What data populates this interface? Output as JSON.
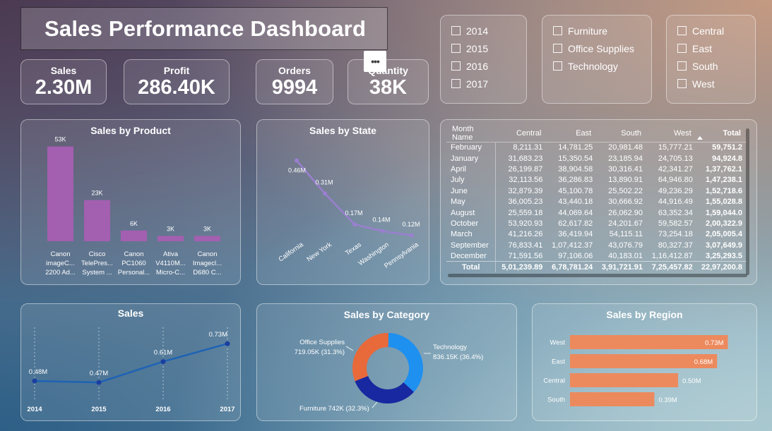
{
  "header": {
    "title": "Sales Performance Dashboard",
    "more_label": "•••"
  },
  "kpis": [
    {
      "label": "Sales",
      "value": "2.30M"
    },
    {
      "label": "Profit",
      "value": "286.40K"
    },
    {
      "label": "Orders",
      "value": "9994"
    },
    {
      "label": "Quantity",
      "value": "38K"
    }
  ],
  "slicers": {
    "years": [
      "2014",
      "2015",
      "2016",
      "2017"
    ],
    "categories": [
      "Furniture",
      "Office Supplies",
      "Technology"
    ],
    "regions": [
      "Central",
      "East",
      "South",
      "West"
    ]
  },
  "sales_by_product": {
    "title": "Sales by Product",
    "bar_color": "#a35fb0",
    "chart_data": {
      "type": "bar",
      "categories": [
        [
          "Canon",
          "imageC...",
          "2200 Ad..."
        ],
        [
          "Cisco",
          "TelePres...",
          "System ..."
        ],
        [
          "Canon",
          "PC1060",
          "Personal..."
        ],
        [
          "Ativa",
          "V4110M...",
          "Micro-C..."
        ],
        [
          "Canon",
          "Imagecl...",
          "D680 C..."
        ]
      ],
      "values": [
        53,
        23,
        6,
        3,
        3
      ],
      "data_labels": [
        "53K",
        "23K",
        "6K",
        "3K",
        "3K"
      ],
      "ylim": [
        0,
        56
      ]
    }
  },
  "sales_by_state": {
    "title": "Sales by State",
    "line_color": "#9a7fd0",
    "chart_data": {
      "type": "line",
      "categories": [
        "California",
        "New York",
        "Texas",
        "Washington",
        "Pennsylvania"
      ],
      "values": [
        0.46,
        0.31,
        0.17,
        0.14,
        0.12
      ],
      "data_labels": [
        "0.46M",
        "0.31M",
        "0.17M",
        "0.14M",
        "0.12M"
      ],
      "ylim": [
        0.1,
        0.5
      ]
    }
  },
  "matrix": {
    "columns": [
      "Month Name",
      "Central",
      "East",
      "South",
      "West",
      "Total"
    ],
    "rows": [
      [
        "February",
        "8,211.31",
        "14,781.25",
        "20,981.48",
        "15,777.21",
        "59,751.2"
      ],
      [
        "January",
        "31,683.23",
        "15,350.54",
        "23,185.94",
        "24,705.13",
        "94,924.8"
      ],
      [
        "April",
        "26,199.87",
        "38,904.58",
        "30,316.41",
        "42,341.27",
        "1,37,762.1"
      ],
      [
        "July",
        "32,113.56",
        "36,286.83",
        "13,890.91",
        "64,946.80",
        "1,47,238.1"
      ],
      [
        "June",
        "32,879.39",
        "45,100.78",
        "25,502.22",
        "49,236.29",
        "1,52,718.6"
      ],
      [
        "May",
        "36,005.23",
        "43,440.18",
        "30,666.92",
        "44,916.49",
        "1,55,028.8"
      ],
      [
        "August",
        "25,559.18",
        "44,069.64",
        "26,062.90",
        "63,352.34",
        "1,59,044.0"
      ],
      [
        "October",
        "53,920.93",
        "62,617.82",
        "24,201.67",
        "59,582.57",
        "2,00,322.9"
      ],
      [
        "March",
        "41,216.26",
        "36,419.94",
        "54,115.11",
        "73,254.18",
        "2,05,005.4"
      ],
      [
        "September",
        "76,833.41",
        "1,07,412.37",
        "43,076.79",
        "80,327.37",
        "3,07,649.9"
      ],
      [
        "December",
        "71,591.56",
        "97,106.06",
        "40,183.01",
        "1,16,412.87",
        "3,25,293.5"
      ]
    ],
    "total": [
      "Total",
      "5,01,239.89",
      "6,78,781.24",
      "3,91,721.91",
      "7,25,457.82",
      "22,97,200.8"
    ]
  },
  "sales_by_year": {
    "title": "Sales",
    "line_color": "#1e63b5",
    "chart_data": {
      "type": "line",
      "categories": [
        "2014",
        "2015",
        "2016",
        "2017"
      ],
      "values": [
        0.48,
        0.47,
        0.61,
        0.73
      ],
      "data_labels": [
        "0.48M",
        "0.47M",
        "0.61M",
        "0.73M"
      ],
      "ylim": [
        0.4,
        0.75
      ]
    }
  },
  "sales_by_category": {
    "title": "Sales by Category",
    "chart_data": {
      "type": "pie",
      "slices": [
        {
          "name": "Technology",
          "value": 836.15,
          "label": "Technology",
          "label2": "836.15K (36.4%)",
          "color": "#1e90f0"
        },
        {
          "name": "Furniture",
          "value": 742,
          "label": "Furniture 742K (32.3%)",
          "label2": "",
          "color": "#1728a0"
        },
        {
          "name": "Office Supplies",
          "value": 719.05,
          "label": "Office Supplies",
          "label2": "719.05K (31.3%)",
          "color": "#e8693a"
        }
      ]
    }
  },
  "sales_by_region": {
    "title": "Sales by Region",
    "bar_color": "#ec8a5e",
    "chart_data": {
      "type": "bar",
      "categories": [
        "West",
        "East",
        "Central",
        "South"
      ],
      "values": [
        0.73,
        0.68,
        0.5,
        0.39
      ],
      "data_labels": [
        "0.73M",
        "0.68M",
        "0.50M",
        "0.39M"
      ],
      "xlim": [
        0,
        0.81
      ]
    }
  }
}
